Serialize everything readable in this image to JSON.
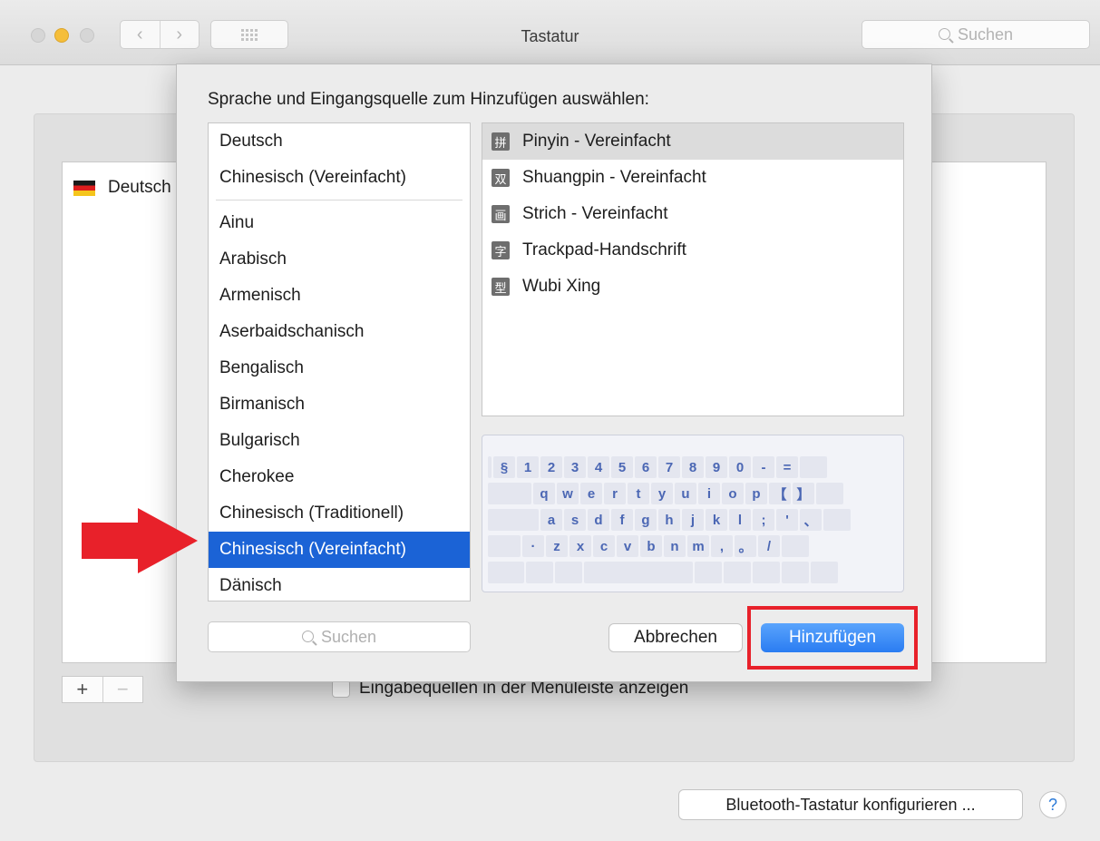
{
  "window": {
    "title": "Tastatur",
    "search_placeholder": "Suchen",
    "back_glyph": "‹",
    "forward_glyph": "›"
  },
  "background": {
    "source_item": "Deutsch",
    "plus": "+",
    "minus": "−",
    "show_in_menubar": "Eingabequellen in der Menüleiste anzeigen",
    "bluetooth_button": "Bluetooth-Tastatur konfigurieren ...",
    "help": "?"
  },
  "sheet": {
    "prompt": "Sprache und Eingangsquelle zum Hinzufügen auswählen:",
    "languages_top": [
      "Deutsch",
      "Chinesisch (Vereinfacht)"
    ],
    "languages": [
      "Ainu",
      "Arabisch",
      "Armenisch",
      "Aserbaidschanisch",
      "Bengalisch",
      "Birmanisch",
      "Bulgarisch",
      "Cherokee",
      "Chinesisch (Traditionell)",
      "Chinesisch (Vereinfacht)",
      "Dänisch"
    ],
    "selected_language": "Chinesisch (Vereinfacht)",
    "methods": [
      {
        "icon": "拼",
        "label": "Pinyin - Vereinfacht"
      },
      {
        "icon": "双",
        "label": "Shuangpin - Vereinfacht"
      },
      {
        "icon": "画",
        "label": "Strich - Vereinfacht"
      },
      {
        "icon": "字",
        "label": "Trackpad-Handschrift"
      },
      {
        "icon": "型",
        "label": "Wubi Xing"
      }
    ],
    "keyboard_rows": [
      [
        "§",
        "1",
        "2",
        "3",
        "4",
        "5",
        "6",
        "7",
        "8",
        "9",
        "0",
        "-",
        "="
      ],
      [
        "q",
        "w",
        "e",
        "r",
        "t",
        "y",
        "u",
        "i",
        "o",
        "p",
        "【",
        "】"
      ],
      [
        "a",
        "s",
        "d",
        "f",
        "g",
        "h",
        "j",
        "k",
        "l",
        ";",
        "'",
        "、"
      ],
      [
        "·",
        "z",
        "x",
        "c",
        "v",
        "b",
        "n",
        "m",
        ",",
        "。",
        "/"
      ]
    ],
    "search_placeholder": "Suchen",
    "cancel_button": "Abbrechen",
    "add_button": "Hinzufügen"
  },
  "colors": {
    "selection": "#1b63d6",
    "accent_button": "#2a7cf2",
    "annotation": "#e8212a",
    "key_text": "#4b67b4"
  }
}
